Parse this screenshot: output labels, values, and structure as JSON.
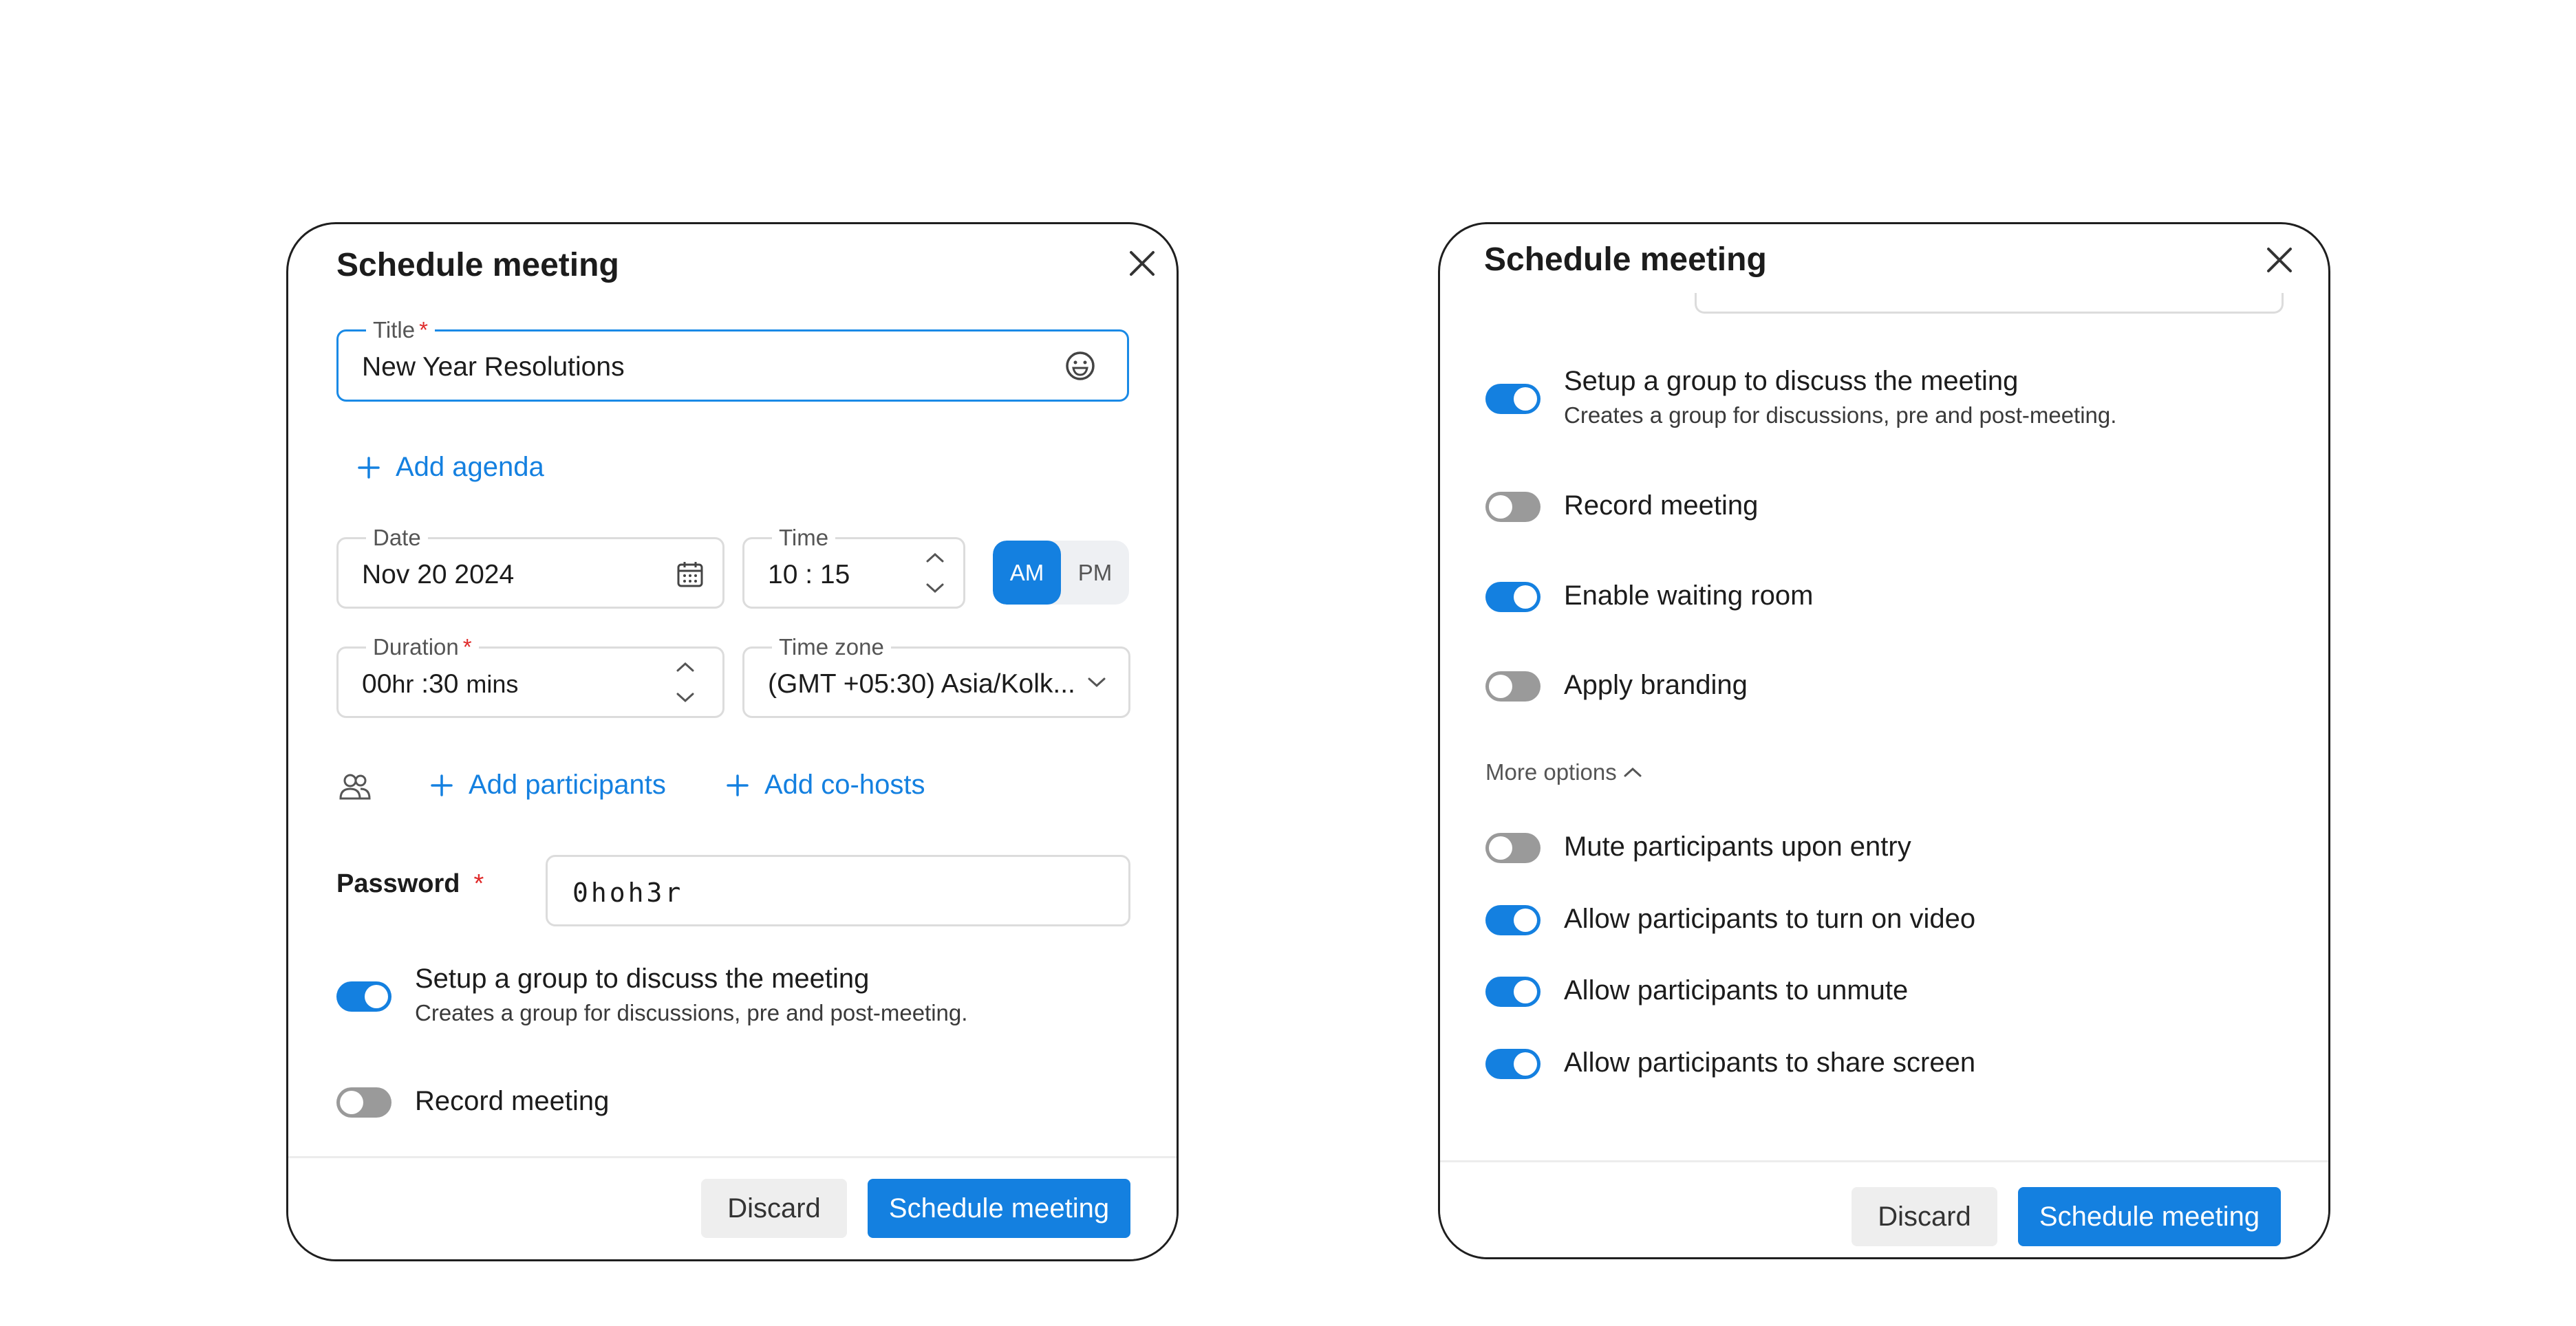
{
  "dialog_a": {
    "title": "Schedule meeting",
    "title_field": {
      "label": "Title",
      "required_mark": "*",
      "value": "New Year Resolutions"
    },
    "add_agenda": "Add agenda",
    "date_field": {
      "label": "Date",
      "value": "Nov 20 2024"
    },
    "time_field": {
      "label": "Time",
      "value": "10 : 15"
    },
    "am_label": "AM",
    "pm_label": "PM",
    "selected_period": "AM",
    "duration_field": {
      "label": "Duration",
      "required_mark": "*",
      "hours": "00",
      "hours_unit": "hr",
      "separator": ":",
      "minutes": "30",
      "minutes_unit": "mins"
    },
    "timezone_field": {
      "label": "Time zone",
      "value": "(GMT +05:30) Asia/Kolk..."
    },
    "add_participants": "Add participants",
    "add_cohosts": "Add co-hosts",
    "password": {
      "label": "Password",
      "required_mark": "*",
      "value": "0hoh3r"
    },
    "toggles": [
      {
        "label": "Setup a group to discuss the meeting",
        "sub": "Creates a group for discussions, pre and post-meeting.",
        "on": true
      },
      {
        "label": "Record meeting",
        "on": false
      }
    ],
    "discard": "Discard",
    "schedule": "Schedule meeting"
  },
  "dialog_b": {
    "title": "Schedule meeting",
    "toggles": [
      {
        "label": "Setup a group to discuss the meeting",
        "sub": "Creates a group for discussions, pre and post-meeting.",
        "on": true
      },
      {
        "label": "Record meeting",
        "on": false
      },
      {
        "label": "Enable waiting room",
        "on": true
      },
      {
        "label": "Apply branding",
        "on": false
      }
    ],
    "more_options": "More options",
    "more_toggles": [
      {
        "label": "Mute participants upon entry",
        "on": false
      },
      {
        "label": "Allow participants to turn on video",
        "on": true
      },
      {
        "label": "Allow participants to unmute",
        "on": true
      },
      {
        "label": "Allow participants to share screen",
        "on": true
      }
    ],
    "discard": "Discard",
    "schedule": "Schedule meeting"
  },
  "colors": {
    "accent": "#1480e0",
    "toggle_off": "#9a9a9a",
    "required": "#e02b2b",
    "border": "#1f1f1f"
  },
  "icons": [
    "close-icon",
    "emoji-icon",
    "plus-icon",
    "calendar-icon",
    "chevron-up-icon",
    "chevron-down-icon",
    "participants-icon"
  ]
}
